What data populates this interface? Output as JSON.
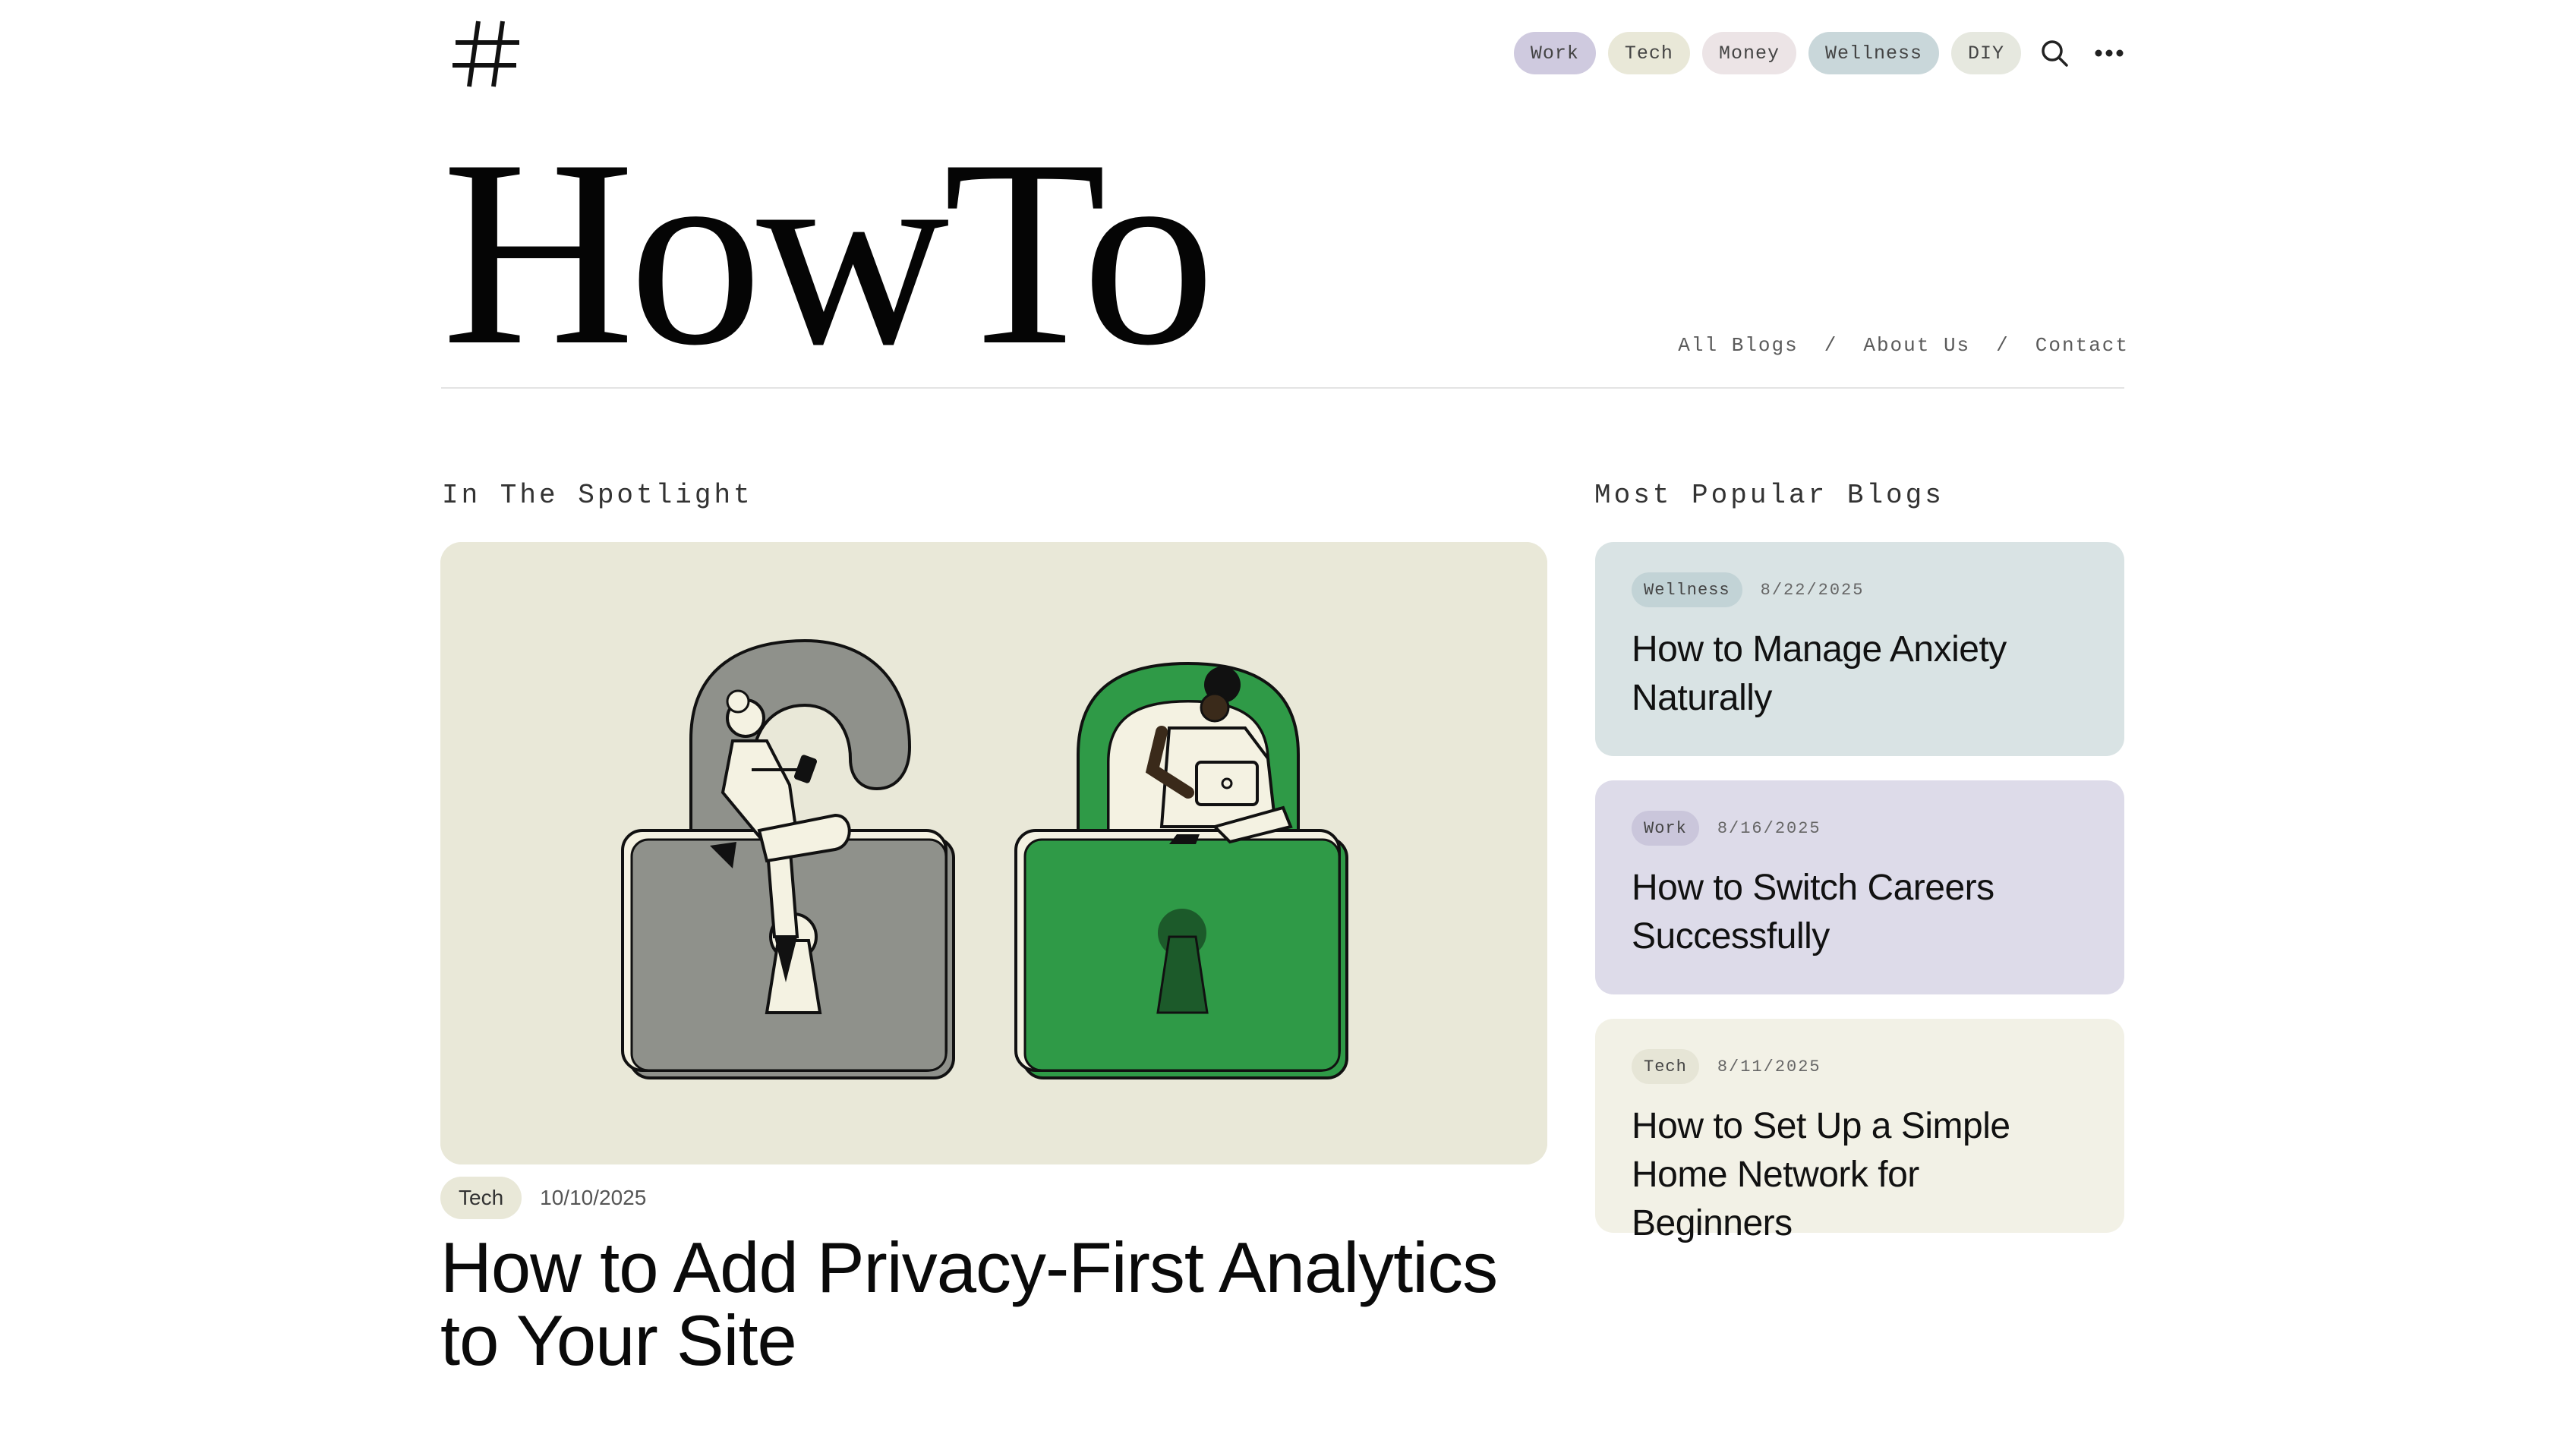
{
  "header": {
    "masthead": "HowTo",
    "categories": [
      {
        "label": "Work",
        "color": "#cfcadf"
      },
      {
        "label": "Tech",
        "color": "#e9e8d8"
      },
      {
        "label": "Money",
        "color": "#ece4e6"
      },
      {
        "label": "Wellness",
        "color": "#c9d7da"
      },
      {
        "label": "DIY",
        "color": "#e6e8df"
      }
    ],
    "search_icon": "search-icon",
    "more_icon": "more-horizontal-icon",
    "links": {
      "all_blogs": "All Blogs",
      "separator": "/",
      "about": "About Us",
      "contact": "Contact"
    }
  },
  "spotlight": {
    "section_title": "In The Spotlight",
    "tag": "Tech",
    "date": "10/10/2025",
    "title": "How to Add Privacy-First Analytics to Your Site"
  },
  "popular": {
    "section_title": "Most Popular Blogs",
    "items": [
      {
        "tag": "Wellness",
        "date": "8/22/2025",
        "title": "How to Manage Anxiety Naturally",
        "bg": "#d9e3e4",
        "tag_bg": "#c2d3d6"
      },
      {
        "tag": "Work",
        "date": "8/16/2025",
        "title": "How to Switch Careers Successfully",
        "bg": "#dddbe9",
        "tag_bg": "#cac6db"
      },
      {
        "tag": "Tech",
        "date": "8/11/2025",
        "title": "How to Set Up a Simple Home Network for Beginners",
        "bg": "#f2f1e6",
        "tag_bg": "#e6e5d6"
      }
    ]
  },
  "colors": {
    "spot_bg": "#e9e8d8",
    "lock_green": "#2f9a47",
    "lock_gray": "#8f918b"
  }
}
